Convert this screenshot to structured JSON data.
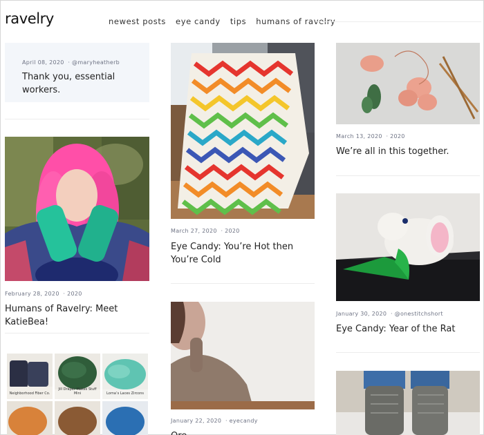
{
  "header": {
    "logo": "ravelry",
    "nav": [
      "newest posts",
      "eye candy",
      "tips",
      "humans of ravelry"
    ]
  },
  "posts": {
    "essential": {
      "date": "April 08, 2020",
      "author": "@maryheatherb",
      "title": "Thank you, essential workers."
    },
    "katiebea": {
      "date": "February 28, 2020",
      "year_tag": "2020",
      "title": "Humans of Ravelry: Meet KatieBea!"
    },
    "hot_cold": {
      "date": "March 27, 2020",
      "year_tag": "2020",
      "title": "Eye Candy: You’re Hot then You’re Cold"
    },
    "eyecandy_jan22": {
      "date": "January 22, 2020",
      "author": "eyecandy",
      "title": "Ore…"
    },
    "together": {
      "date": "March 13, 2020",
      "year_tag": "2020",
      "title": "We’re all in this together."
    },
    "rat": {
      "date": "January 30, 2020",
      "author": "@onestitchshort",
      "title": "Eye Candy: Year of the Rat"
    }
  },
  "mini_grid": {
    "captions": [
      "Neighborhood Fiber Co.",
      "Jill Draper Makes Stuff Mini",
      "Lorna’s Laces Zircons",
      "",
      "",
      ""
    ]
  },
  "colors": {
    "box_bg": "#f3f6fa",
    "meta": "#6e7384",
    "rule": "#ececec"
  }
}
